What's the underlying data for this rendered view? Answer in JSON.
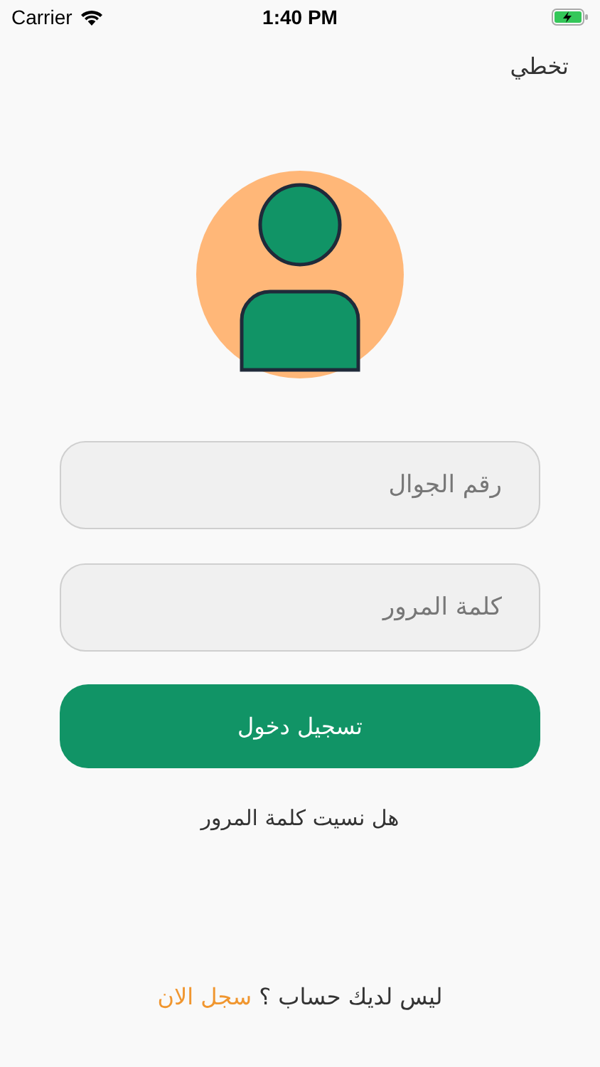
{
  "status_bar": {
    "carrier": "Carrier",
    "time": "1:40 PM"
  },
  "skip": "تخطي",
  "fields": [
    {
      "placeholder": "رقم الجوال"
    },
    {
      "placeholder": "كلمة المرور"
    }
  ],
  "login_button": "تسجيل دخول",
  "forgot_password": "هل نسيت كلمة المرور",
  "signup": {
    "prompt": "ليس لديك حساب ؟",
    "link": "سجل الان"
  }
}
